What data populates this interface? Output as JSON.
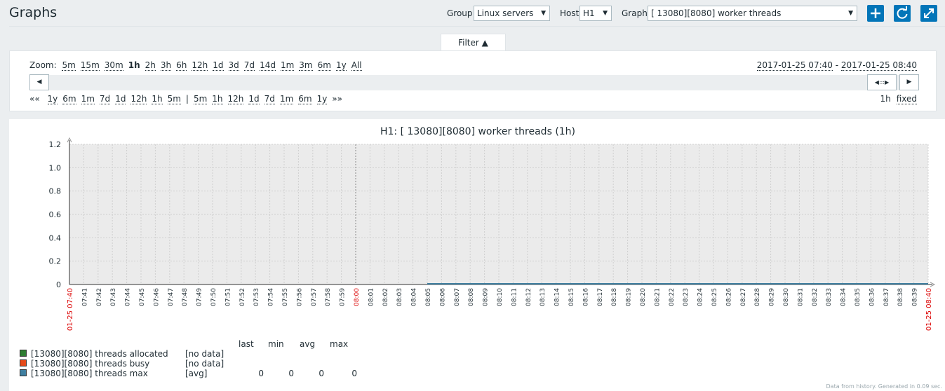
{
  "page": {
    "title": "Graphs"
  },
  "header": {
    "group_label": "Group",
    "group_value": "Linux servers",
    "host_label": "Host",
    "host_value": "H1",
    "graph_label": "Graph",
    "graph_value": "[ 13080][8080] worker threads",
    "buttons": [
      "plus-icon",
      "refresh-icon",
      "fullscreen-icon"
    ]
  },
  "filter": {
    "tab_label": "Filter ▲",
    "zoom_label": "Zoom:",
    "zoom_options": [
      "5m",
      "15m",
      "30m",
      "1h",
      "2h",
      "3h",
      "6h",
      "12h",
      "1d",
      "3d",
      "7d",
      "14d",
      "1m",
      "3m",
      "6m",
      "1y",
      "All"
    ],
    "zoom_active": "1h",
    "range_from": "2017-01-25 07:40",
    "range_sep": " - ",
    "range_to": "2017-01-25 08:40",
    "back_label": "««",
    "back_options": [
      "1y",
      "6m",
      "1m",
      "7d",
      "1d",
      "12h",
      "1h",
      "5m"
    ],
    "separator": "|",
    "fwd_options": [
      "5m",
      "1h",
      "12h",
      "1d",
      "7d",
      "1m",
      "6m",
      "1y"
    ],
    "fwd_label": "»»",
    "period_label": "1h",
    "fixed_label": "fixed"
  },
  "graph": {
    "title": "H1: [ 13080][8080] worker threads (1h)",
    "legend_headers": [
      "last",
      "min",
      "avg",
      "max"
    ],
    "legend": [
      {
        "name": "[13080][8080] threads allocated",
        "color": "#2e7d32",
        "func": "[no data]",
        "values": [
          "",
          "",
          "",
          ""
        ]
      },
      {
        "name": "[13080][8080] threads busy",
        "color": "#e64a19",
        "func": "[no data]",
        "values": [
          "",
          "",
          "",
          ""
        ]
      },
      {
        "name": "[13080][8080] threads max",
        "color": "#3f7fa0",
        "func": "[avg]",
        "values": [
          "0",
          "0",
          "0",
          "0"
        ]
      }
    ],
    "footer": "Data from history. Generated in 0.09 sec."
  },
  "chart_data": {
    "type": "line",
    "title": "H1: [ 13080][8080] worker threads (1h)",
    "ylim": [
      0,
      1.2
    ],
    "yticks": [
      "0",
      "0.2",
      "0.4",
      "0.6",
      "0.8",
      "1.0",
      "1.2"
    ],
    "x_start_label": "01-25 07:40",
    "x_end_label": "01-25 08:40",
    "x_ticks": [
      "07:41",
      "07:42",
      "07:43",
      "07:44",
      "07:45",
      "07:46",
      "07:47",
      "07:48",
      "07:49",
      "07:50",
      "07:51",
      "07:52",
      "07:53",
      "07:54",
      "07:55",
      "07:56",
      "07:57",
      "07:58",
      "07:59",
      "08:00",
      "08:01",
      "08:02",
      "08:03",
      "08:04",
      "08:05",
      "08:06",
      "08:07",
      "08:08",
      "08:09",
      "08:10",
      "08:11",
      "08:12",
      "08:13",
      "08:14",
      "08:15",
      "08:16",
      "08:17",
      "08:18",
      "08:19",
      "08:20",
      "08:21",
      "08:22",
      "08:23",
      "08:24",
      "08:25",
      "08:26",
      "08:27",
      "08:28",
      "08:29",
      "08:30",
      "08:31",
      "08:32",
      "08:33",
      "08:34",
      "08:35",
      "08:36",
      "08:37",
      "08:38",
      "08:39"
    ],
    "highlight_tick": "08:00",
    "highlight_color": "#dc0000",
    "grid": true,
    "series": [
      {
        "name": "[13080][8080] threads max",
        "color": "#3f7fa0",
        "x_range": [
          "08:05",
          "08:40"
        ],
        "values": [
          0,
          0
        ]
      }
    ]
  }
}
